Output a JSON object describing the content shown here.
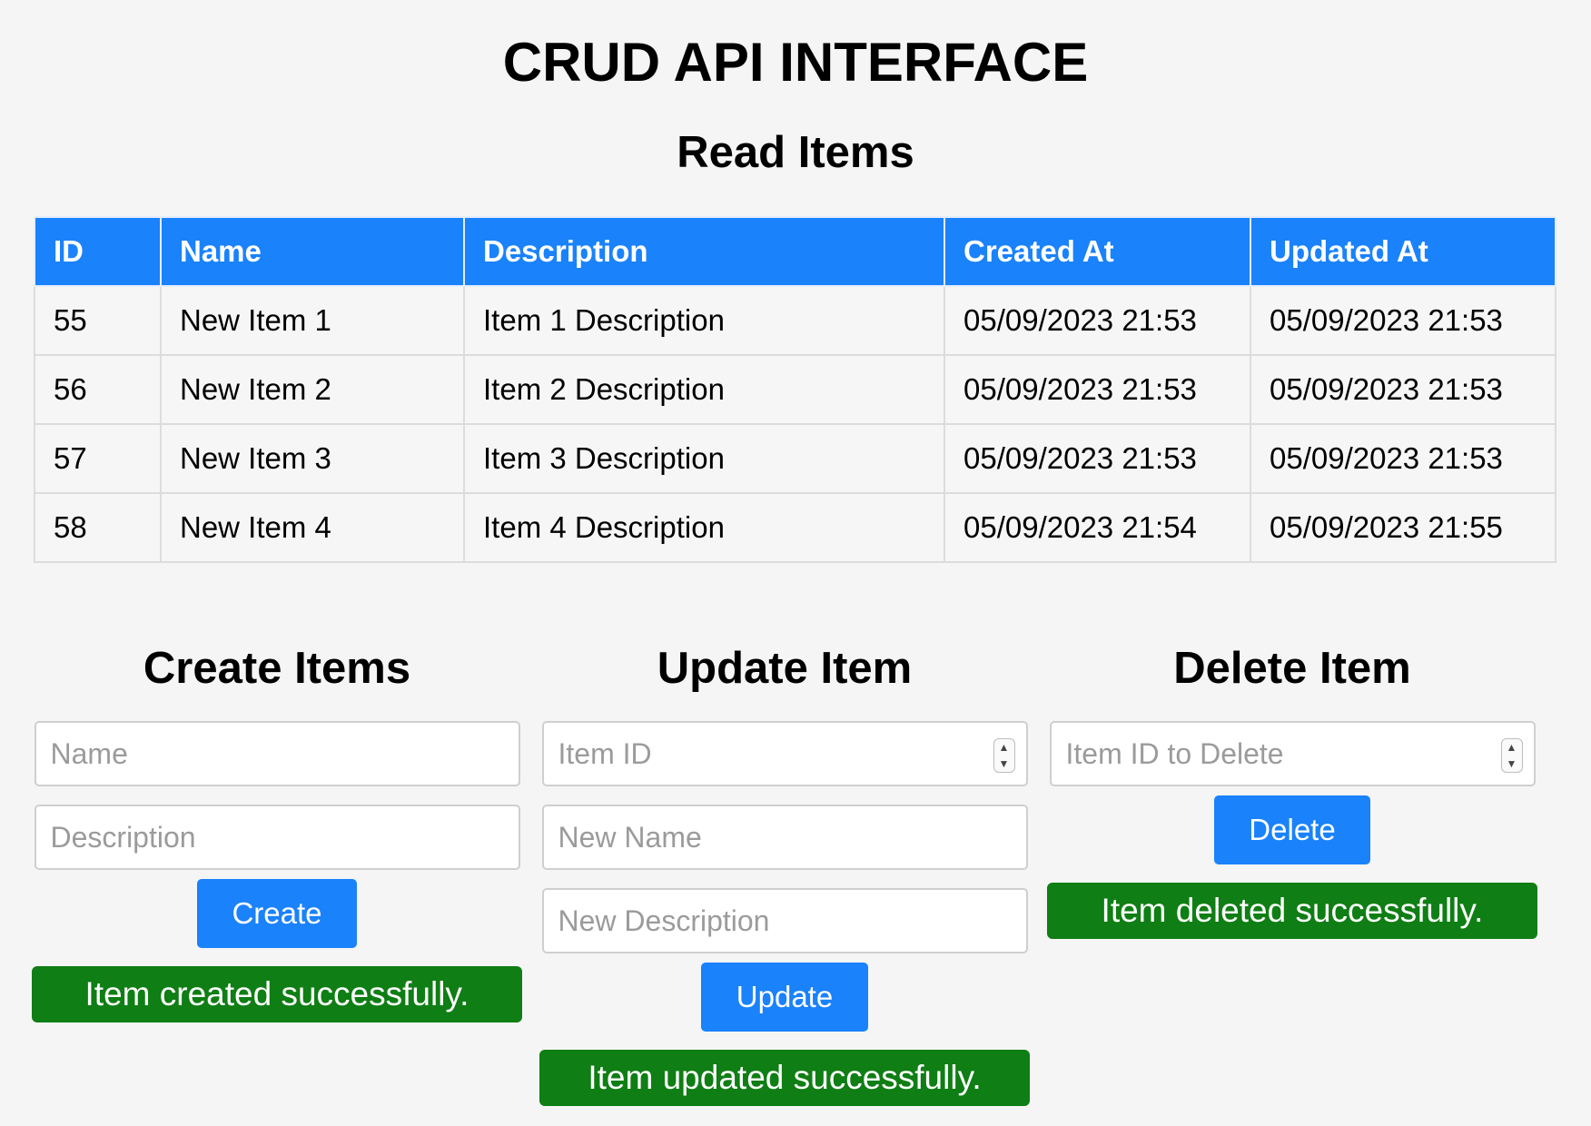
{
  "page": {
    "title": "CRUD API INTERFACE"
  },
  "read": {
    "title": "Read Items",
    "columns": [
      "ID",
      "Name",
      "Description",
      "Created At",
      "Updated At"
    ],
    "rows": [
      [
        "55",
        "New Item 1",
        "Item 1 Description",
        "05/09/2023 21:53",
        "05/09/2023 21:53"
      ],
      [
        "56",
        "New Item 2",
        "Item 2 Description",
        "05/09/2023 21:53",
        "05/09/2023 21:53"
      ],
      [
        "57",
        "New Item 3",
        "Item 3 Description",
        "05/09/2023 21:53",
        "05/09/2023 21:53"
      ],
      [
        "58",
        "New Item 4",
        "Item 4 Description",
        "05/09/2023 21:54",
        "05/09/2023 21:55"
      ]
    ]
  },
  "create": {
    "title": "Create Items",
    "name_placeholder": "Name",
    "description_placeholder": "Description",
    "button_label": "Create",
    "status": "Item created successfully."
  },
  "update": {
    "title": "Update Item",
    "id_placeholder": "Item ID",
    "name_placeholder": "New Name",
    "description_placeholder": "New Description",
    "button_label": "Update",
    "status": "Item updated successfully."
  },
  "delete": {
    "title": "Delete Item",
    "id_placeholder": "Item ID to Delete",
    "button_label": "Delete",
    "status": "Item deleted successfully."
  },
  "colors": {
    "accent": "#1a82fb",
    "success": "#0f7e14",
    "background": "#f5f5f5"
  },
  "icons": {
    "spinner": "number-spinner-icon"
  }
}
